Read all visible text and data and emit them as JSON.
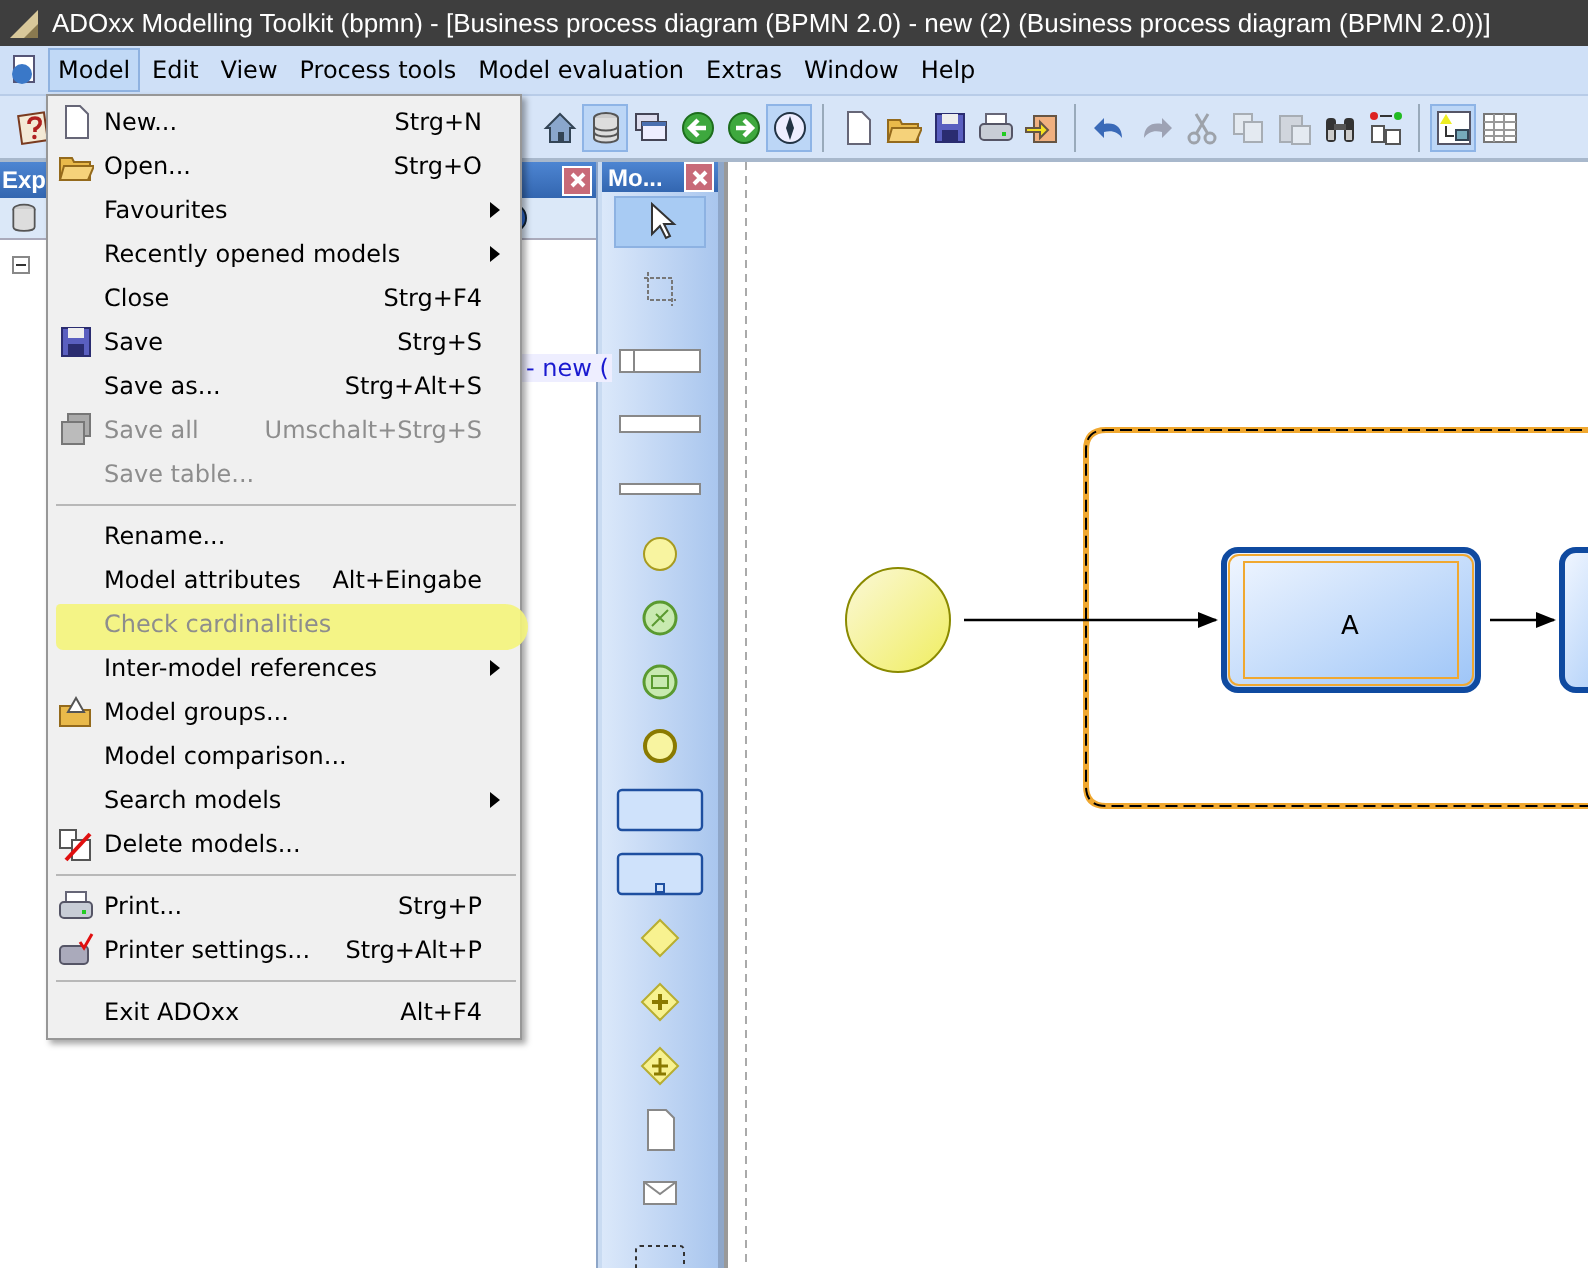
{
  "window": {
    "title": "ADOxx Modelling Toolkit (bpmn) - [Business process diagram (BPMN 2.0) - new (2) (Business process diagram (BPMN 2.0))]"
  },
  "menu_bar": [
    {
      "label": "Model",
      "selected": true
    },
    {
      "label": "Edit",
      "selected": false
    },
    {
      "label": "View",
      "selected": false
    },
    {
      "label": "Process tools",
      "selected": false
    },
    {
      "label": "Model evaluation",
      "selected": false
    },
    {
      "label": "Extras",
      "selected": false
    },
    {
      "label": "Window",
      "selected": false
    },
    {
      "label": "Help",
      "selected": false
    }
  ],
  "toolbar": [
    {
      "kind": "help",
      "selected": false,
      "disabled": false
    },
    {
      "kind": "home",
      "selected": false,
      "disabled": false
    },
    {
      "kind": "database",
      "selected": true,
      "disabled": false
    },
    {
      "kind": "windows",
      "selected": false,
      "disabled": false
    },
    {
      "kind": "back",
      "selected": false,
      "disabled": false
    },
    {
      "kind": "forward",
      "selected": false,
      "disabled": false
    },
    {
      "kind": "compass",
      "selected": true,
      "disabled": false
    },
    {
      "kind": "separator"
    },
    {
      "kind": "new",
      "selected": false,
      "disabled": false
    },
    {
      "kind": "open",
      "selected": false,
      "disabled": false
    },
    {
      "kind": "save",
      "selected": false,
      "disabled": false
    },
    {
      "kind": "print",
      "selected": false,
      "disabled": false
    },
    {
      "kind": "import",
      "selected": false,
      "disabled": false
    },
    {
      "kind": "separator"
    },
    {
      "kind": "undo",
      "selected": false,
      "disabled": false
    },
    {
      "kind": "redo",
      "selected": false,
      "disabled": true
    },
    {
      "kind": "cut",
      "selected": false,
      "disabled": true
    },
    {
      "kind": "copy",
      "selected": false,
      "disabled": true
    },
    {
      "kind": "paste",
      "selected": false,
      "disabled": true
    },
    {
      "kind": "find",
      "selected": false,
      "disabled": false
    },
    {
      "kind": "compare",
      "selected": false,
      "disabled": false
    },
    {
      "kind": "separator"
    },
    {
      "kind": "mode",
      "selected": true,
      "disabled": false
    },
    {
      "kind": "table",
      "selected": false,
      "disabled": false
    }
  ],
  "explorer": {
    "title": "Exp",
    "tree_item": "- new ("
  },
  "palette": {
    "title": "Mo...",
    "items": [
      {
        "kind": "pointer",
        "selected": true
      },
      {
        "kind": "crop",
        "selected": false
      },
      {
        "kind": "separator"
      },
      {
        "kind": "pool",
        "selected": false
      },
      {
        "kind": "lane",
        "selected": false
      },
      {
        "kind": "lane_thin",
        "selected": false
      },
      {
        "kind": "start_event",
        "selected": false
      },
      {
        "kind": "event_conditional",
        "selected": false
      },
      {
        "kind": "event_message",
        "selected": false
      },
      {
        "kind": "end_event",
        "selected": false
      },
      {
        "kind": "task",
        "selected": false
      },
      {
        "kind": "subprocess",
        "selected": false
      },
      {
        "kind": "gateway",
        "selected": false
      },
      {
        "kind": "gateway_parallel",
        "selected": false
      },
      {
        "kind": "gateway_complex",
        "selected": false
      },
      {
        "kind": "data_object",
        "selected": false
      },
      {
        "kind": "message",
        "selected": false
      },
      {
        "kind": "group",
        "selected": false
      }
    ]
  },
  "model_menu": [
    {
      "kind": "new",
      "label": "New...",
      "shortcut": "Strg+N",
      "submenu": false,
      "disabled": false,
      "highlighted": false
    },
    {
      "kind": "open",
      "label": "Open...",
      "shortcut": "Strg+O",
      "submenu": false,
      "disabled": false,
      "highlighted": false
    },
    {
      "kind": "item",
      "label": "Favourites",
      "submenu": true,
      "disabled": false,
      "highlighted": false
    },
    {
      "kind": "item",
      "label": "Recently opened models",
      "submenu": true,
      "disabled": false,
      "highlighted": false
    },
    {
      "kind": "item",
      "label": "Close",
      "shortcut": "Strg+F4",
      "submenu": false,
      "disabled": false,
      "highlighted": false
    },
    {
      "kind": "save",
      "label": "Save",
      "shortcut": "Strg+S",
      "submenu": false,
      "disabled": false,
      "highlighted": false
    },
    {
      "kind": "item",
      "label": "Save as...",
      "shortcut": "Strg+Alt+S",
      "submenu": false,
      "disabled": false,
      "highlighted": false
    },
    {
      "kind": "save_all",
      "label": "Save all",
      "shortcut": "Umschalt+Strg+S",
      "submenu": false,
      "disabled": true,
      "highlighted": false
    },
    {
      "kind": "item",
      "label": "Save table...",
      "submenu": false,
      "disabled": true,
      "highlighted": false
    },
    {
      "kind": "separator"
    },
    {
      "kind": "item",
      "label": "Rename...",
      "submenu": false,
      "disabled": false,
      "highlighted": false
    },
    {
      "kind": "item",
      "label": "Model attributes",
      "shortcut": "Alt+Eingabe",
      "submenu": false,
      "disabled": false,
      "highlighted": false
    },
    {
      "kind": "item",
      "label": "Check cardinalities",
      "submenu": false,
      "disabled": true,
      "highlighted": true
    },
    {
      "kind": "item",
      "label": "Inter-model references",
      "submenu": true,
      "disabled": false,
      "highlighted": false
    },
    {
      "kind": "model_groups",
      "label": "Model groups...",
      "submenu": false,
      "disabled": false,
      "highlighted": false
    },
    {
      "kind": "item",
      "label": "Model comparison...",
      "submenu": false,
      "disabled": false,
      "highlighted": false
    },
    {
      "kind": "item",
      "label": "Search models",
      "submenu": true,
      "disabled": false,
      "highlighted": false
    },
    {
      "kind": "delete",
      "label": "Delete models...",
      "submenu": false,
      "disabled": false,
      "highlighted": false
    },
    {
      "kind": "separator"
    },
    {
      "kind": "print",
      "label": "Print...",
      "shortcut": "Strg+P",
      "submenu": false,
      "disabled": false,
      "highlighted": false
    },
    {
      "kind": "printer_settings",
      "label": "Printer settings...",
      "shortcut": "Strg+Alt+P",
      "submenu": false,
      "disabled": false,
      "highlighted": false
    },
    {
      "kind": "separator"
    },
    {
      "kind": "item",
      "label": "Exit ADOxx",
      "shortcut": "Alt+F4",
      "submenu": false,
      "disabled": false,
      "highlighted": false
    }
  ],
  "diagram": {
    "tasks": [
      {
        "label": "A"
      }
    ]
  }
}
